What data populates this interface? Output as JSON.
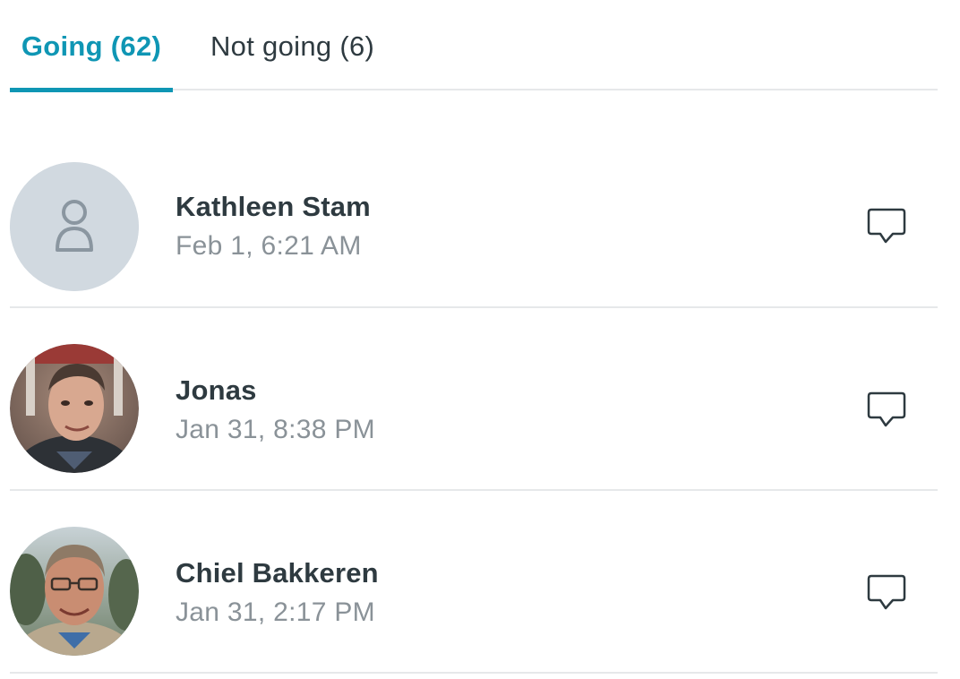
{
  "tabs": [
    {
      "label": "Going (62)",
      "active": true
    },
    {
      "label": "Not going (6)",
      "active": false
    }
  ],
  "attendees": [
    {
      "name": "Kathleen Stam",
      "date": "Feb 1, 6:21 AM",
      "avatar": "default-person-icon"
    },
    {
      "name": "Jonas",
      "date": "Jan 31, 8:38 PM",
      "avatar": "photo"
    },
    {
      "name": "Chiel Bakkeren",
      "date": "Jan 31, 2:17 PM",
      "avatar": "photo"
    }
  ],
  "icons": {
    "comment": "speech-bubble-icon"
  },
  "colors": {
    "accent": "#0f96b4",
    "text": "#2e3a40",
    "muted": "#8a9298",
    "divider": "#e6e8ea",
    "placeholder_avatar": "#d1d9e0"
  }
}
